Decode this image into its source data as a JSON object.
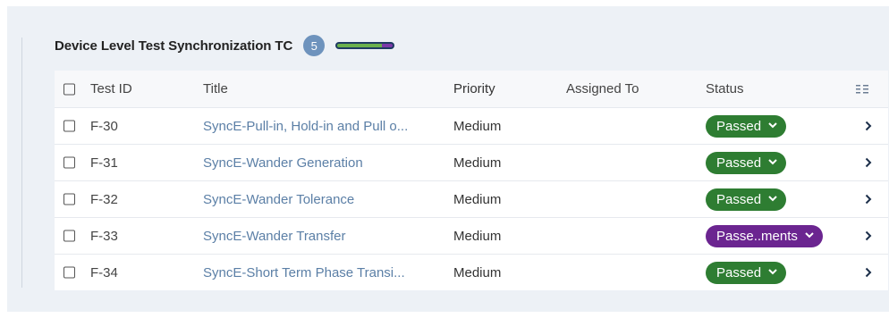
{
  "group": {
    "title": "Device Level Test Synchronization TC",
    "count": "5",
    "progress": {
      "passed_fraction": 0.8,
      "other_fraction": 0.2,
      "passed_color": "#6ab04c",
      "other_color": "#7b3aa8"
    }
  },
  "table": {
    "columns": {
      "test_id": "Test ID",
      "title": "Title",
      "priority": "Priority",
      "assigned_to": "Assigned To",
      "status": "Status"
    },
    "column_settings_icon": "column-layout-icon",
    "rows": [
      {
        "id": "F-30",
        "title": "SyncE-Pull-in, Hold-in and Pull o...",
        "priority": "Medium",
        "assigned_to": "",
        "status": "Passed",
        "status_color": "#2e7d32"
      },
      {
        "id": "F-31",
        "title": "SyncE-Wander Generation",
        "priority": "Medium",
        "assigned_to": "",
        "status": "Passed",
        "status_color": "#2e7d32"
      },
      {
        "id": "F-32",
        "title": "SyncE-Wander Tolerance",
        "priority": "Medium",
        "assigned_to": "",
        "status": "Passed",
        "status_color": "#2e7d32"
      },
      {
        "id": "F-33",
        "title": "SyncE-Wander Transfer",
        "priority": "Medium",
        "assigned_to": "",
        "status": "Passe..ments",
        "status_color": "#6b2590"
      },
      {
        "id": "F-34",
        "title": "SyncE-Short Term Phase Transi...",
        "priority": "Medium",
        "assigned_to": "",
        "status": "Passed",
        "status_color": "#2e7d32"
      }
    ]
  }
}
